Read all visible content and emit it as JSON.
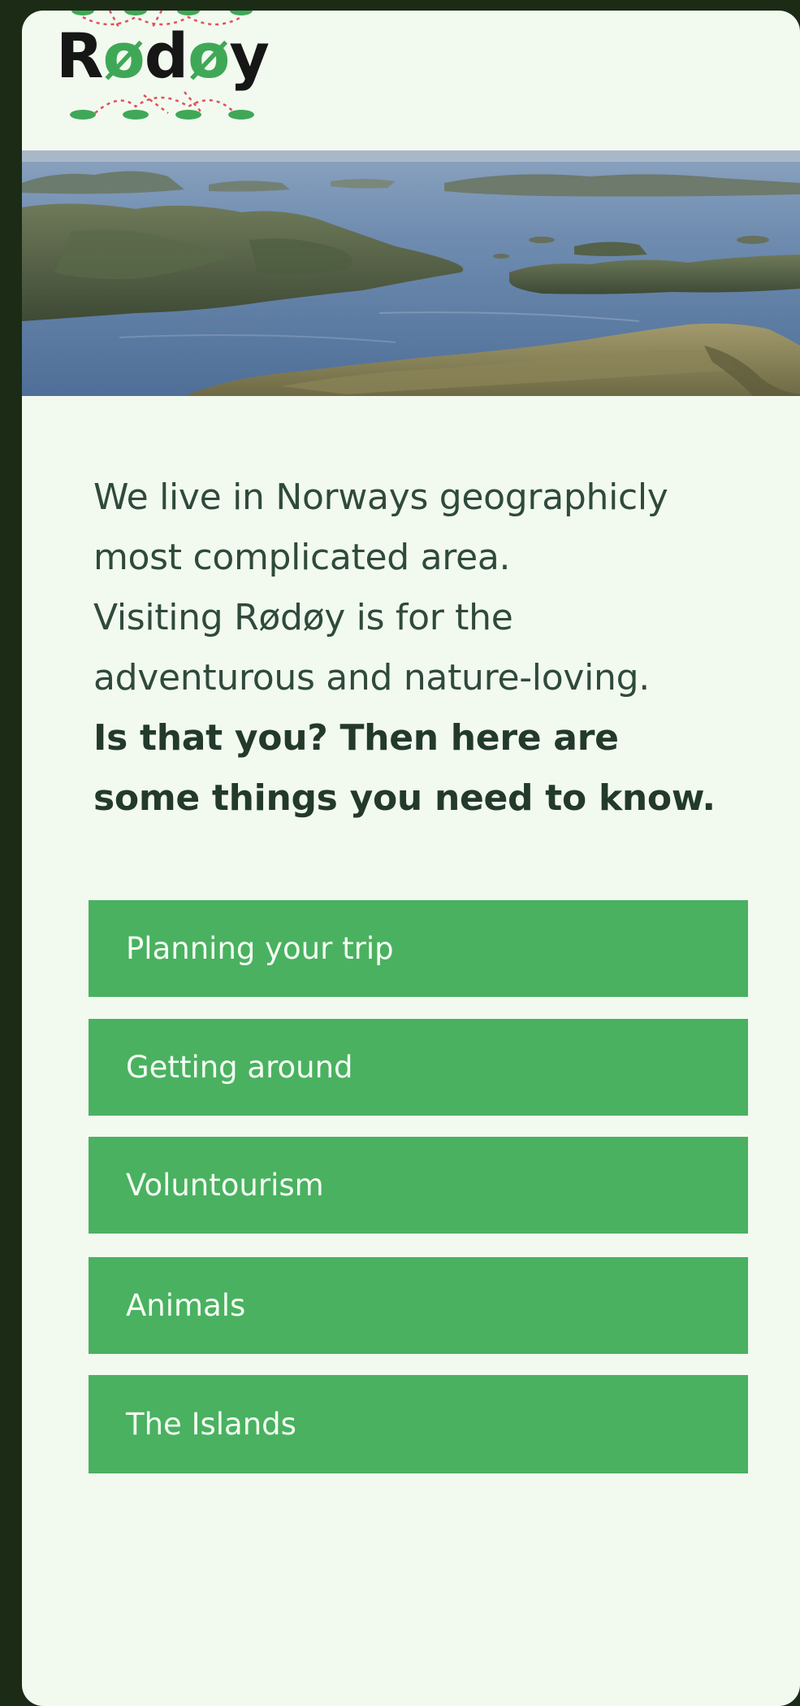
{
  "logo": {
    "brand": "Rødøy",
    "part1": "R",
    "part2": "ø",
    "part3": "d",
    "part4": "ø",
    "part5": "y"
  },
  "hero": {
    "image_description": "aerial landscape photo"
  },
  "intro": {
    "line1": "We live in Norways geographicly",
    "line2": "most complicated area.",
    "line3": "Visiting Rødøy is for the",
    "line4": "adventurous and nature-loving.",
    "bold_line1": "Is that you? Then here are",
    "bold_line2": "some things you need to know."
  },
  "menu": {
    "items": [
      {
        "label": "Planning your trip"
      },
      {
        "label": "Getting around"
      },
      {
        "label": "Voluntourism"
      },
      {
        "label": "Animals"
      },
      {
        "label": "The Islands"
      }
    ]
  },
  "colors": {
    "background": "#1b2b16",
    "screen": "#f2faf0",
    "accent_green": "#4ab161",
    "logo_green": "#3fa857",
    "text": "#2f4a3a"
  }
}
